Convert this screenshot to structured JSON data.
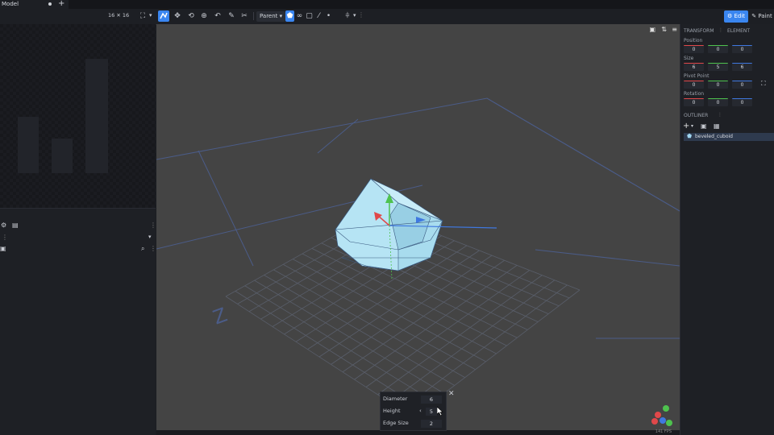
{
  "tabbar": {
    "tab_title": "Model",
    "add_tab_label": "+"
  },
  "toolbar": {
    "resolution": "16 ✕ 16",
    "fullscreen_icon": "⛶",
    "pivot_dropdown": "Parent ▾",
    "mode_edit": "Edit",
    "mode_paint": "Paint"
  },
  "right_panel": {
    "tabs": {
      "transform": "TRANSFORM",
      "element": "ELEMENT"
    },
    "position": {
      "label": "Position",
      "x": "0",
      "y": "0",
      "z": "0"
    },
    "size": {
      "label": "Size",
      "x": "6",
      "y": "5",
      "z": "6"
    },
    "pivot": {
      "label": "Pivot Point",
      "x": "0",
      "y": "0",
      "z": "0"
    },
    "rotation": {
      "label": "Rotation",
      "x": "0",
      "y": "0",
      "z": "0"
    },
    "outliner": {
      "title": "OUTLINER",
      "item": "beveled_cuboid"
    }
  },
  "dialog": {
    "diameter_label": "Diameter",
    "diameter_value": "6",
    "height_label": "Height",
    "height_value": "5",
    "edge_label": "Edge Size",
    "edge_value": "2"
  },
  "viewport": {
    "fps": "141 FPS"
  },
  "colors": {
    "accent": "#3a86f0",
    "axis_x": "#e0484a",
    "axis_y": "#4ec24e",
    "axis_z": "#3f78e0",
    "mesh": "#a8dcee"
  }
}
